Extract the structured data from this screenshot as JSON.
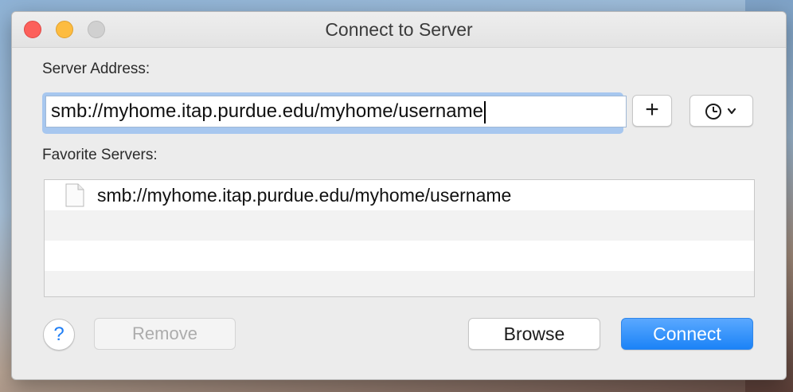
{
  "window": {
    "title": "Connect to Server"
  },
  "server_address": {
    "label": "Server Address:",
    "value": "smb://myhome.itap.purdue.edu/myhome/username"
  },
  "toolbar": {
    "add_label": "+",
    "add_icon": "plus-icon",
    "history_icon": "clock-icon",
    "history_chevron": "chevron-down-icon"
  },
  "favorites": {
    "label": "Favorite Servers:",
    "items": [
      {
        "text": "smb://myhome.itap.purdue.edu/myhome/username",
        "icon": "document-icon"
      }
    ]
  },
  "footer": {
    "help_label": "?",
    "remove_label": "Remove",
    "browse_label": "Browse",
    "connect_label": "Connect"
  },
  "colors": {
    "accent": "#1b83f7",
    "close": "#fc605b",
    "minimize": "#fdbc40",
    "zoom_disabled": "#d0d0d0"
  }
}
